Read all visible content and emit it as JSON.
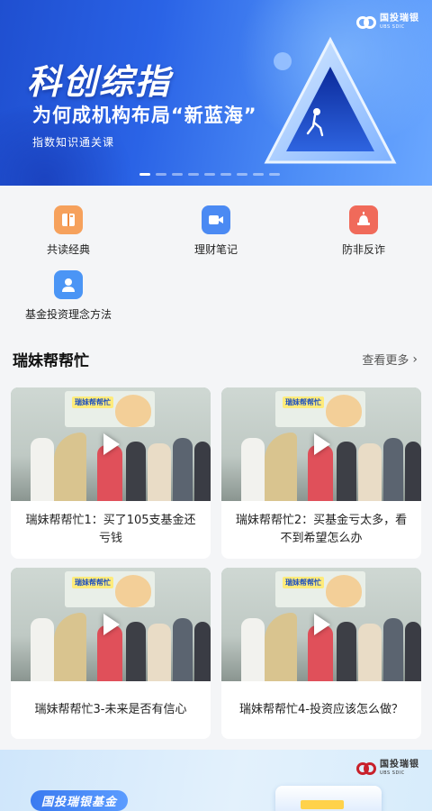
{
  "banner": {
    "logo_cn": "国投瑞银",
    "logo_en": "UBS SDIC",
    "title": "科创综指",
    "subtitle": "为何成机构布局“新蓝海”",
    "tag": "指数知识通关课",
    "slide_count": 9,
    "active_slide": 1
  },
  "menu": {
    "items": [
      {
        "label": "共读经典",
        "icon": "book-icon",
        "color": "#f08a3c"
      },
      {
        "label": "理财笔记",
        "icon": "video-camera-icon",
        "color": "#3c7cf0"
      },
      {
        "label": "防非反诈",
        "icon": "alarm-siren-icon",
        "color": "#ee5a4a"
      },
      {
        "label": "基金投资理念方法",
        "icon": "advisor-person-icon",
        "color": "#3c8cf0"
      }
    ]
  },
  "section": {
    "title": "瑞妹帮帮忙",
    "more_label": "查看更多"
  },
  "videos": [
    {
      "title": "瑞妹帮帮忙1：买了105支基金还亏钱",
      "poster_text": "瑞妹帮帮忙"
    },
    {
      "title": "瑞妹帮帮忙2：买基金亏太多，看不到希望怎么办",
      "poster_text": "瑞妹帮帮忙"
    },
    {
      "title": "瑞妹帮帮忙3-未来是否有信心",
      "poster_text": "瑞妹帮帮忙"
    },
    {
      "title": "瑞妹帮帮忙4-投资应该怎么做？",
      "poster_text": "瑞妹帮帮忙"
    }
  ],
  "bottom_banner": {
    "pill": "国投瑞银基金",
    "logo_cn": "国投瑞银",
    "logo_en": "UBS SDIC"
  }
}
